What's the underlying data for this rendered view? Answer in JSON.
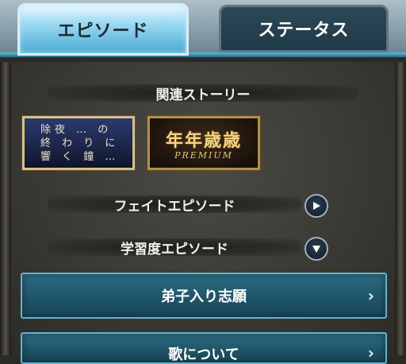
{
  "tabs": {
    "episode": "エピソード",
    "status": "ステータス"
  },
  "sections": {
    "related": "関連ストーリー",
    "fate": "フェイトエピソード",
    "study": "学習度エピソード"
  },
  "banners": {
    "joya_title": "除夜 … の\n終 わ り に\n響 く 鐘 …",
    "premium_kanji": "年年歳歳",
    "premium_label": "PREMIUM"
  },
  "list": {
    "disciple": "弟子入り志願",
    "song": "歌について"
  },
  "icons": {
    "fate_toggle": "play-right-icon",
    "study_toggle": "play-down-icon",
    "chevron": "chevron-right-icon"
  }
}
